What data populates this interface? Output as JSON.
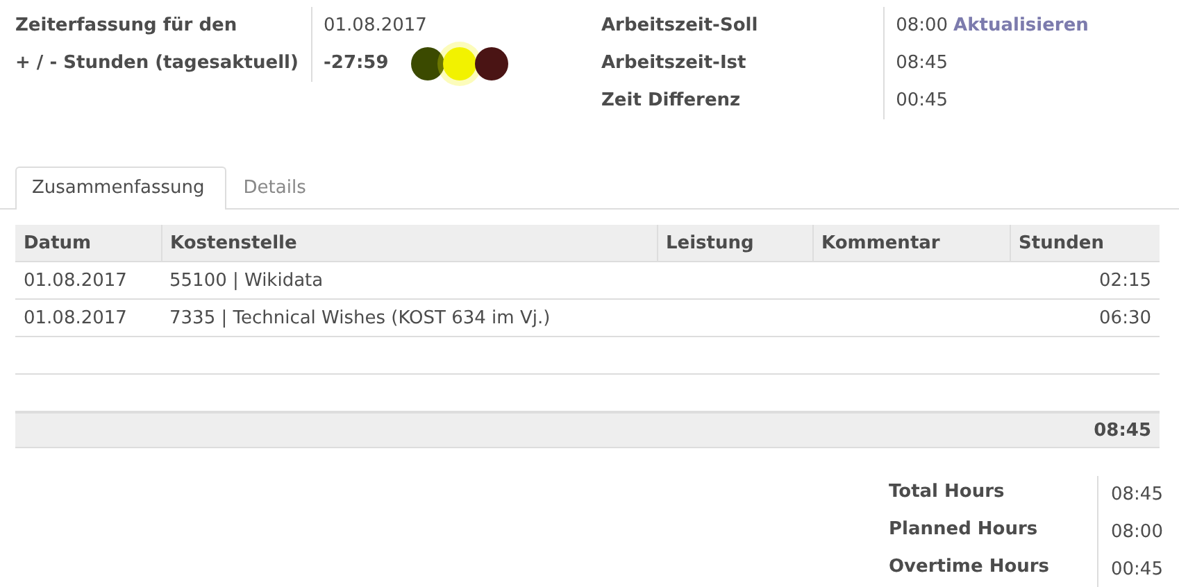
{
  "header_left": [
    {
      "label": "Zeiterfassung für den",
      "value": "01.08.2017",
      "kind": "plain"
    },
    {
      "label": "+ / - Stunden (tagesaktuell)",
      "value": "-27:59",
      "kind": "balance"
    }
  ],
  "traffic_light": [
    {
      "color": "#3b4a00",
      "on": false
    },
    {
      "color": "#f2f200",
      "on": true
    },
    {
      "color": "#4a1414",
      "on": false
    }
  ],
  "header_right": [
    {
      "label": "Arbeitszeit-Soll",
      "value": "08:00",
      "link": "Aktualisieren"
    },
    {
      "label": "Arbeitszeit-Ist",
      "value": "08:45"
    },
    {
      "label": "Zeit Differenz",
      "value": "00:45"
    }
  ],
  "tabs": [
    {
      "label": "Zusammenfassung",
      "selected": true
    },
    {
      "label": "Details",
      "selected": false
    }
  ],
  "table": {
    "columns": [
      "Datum",
      "Kostenstelle",
      "Leistung",
      "Kommentar",
      "Stunden"
    ],
    "rows": [
      [
        "01.08.2017",
        "55100 | Wikidata",
        "",
        "",
        "02:15"
      ],
      [
        "01.08.2017",
        "7335 | Technical Wishes (KOST 634 im Vj.)",
        "",
        "",
        "06:30"
      ]
    ],
    "total": "08:45"
  },
  "summary": [
    {
      "label": "Total Hours",
      "value": "08:45"
    },
    {
      "label": "Planned Hours",
      "value": "08:00"
    },
    {
      "label": "Overtime Hours",
      "value": "00:45"
    }
  ]
}
